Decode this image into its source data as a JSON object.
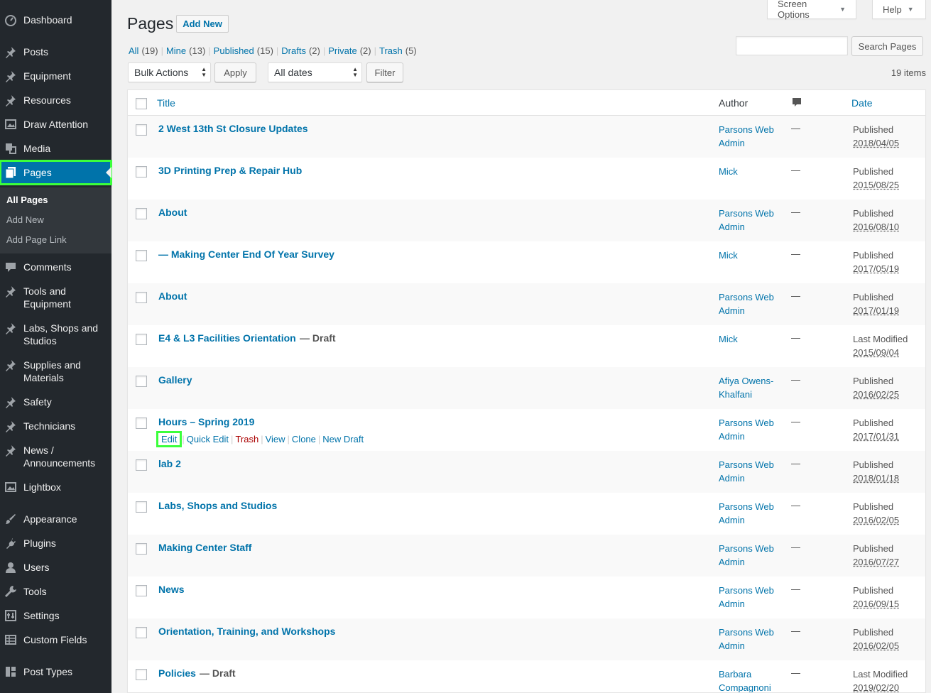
{
  "sidebar": {
    "items": [
      {
        "id": "dashboard",
        "label": "Dashboard",
        "icon": "dashboard-icon"
      },
      {
        "id": "posts",
        "label": "Posts",
        "icon": "pin-icon"
      },
      {
        "id": "equipment",
        "label": "Equipment",
        "icon": "pin-icon"
      },
      {
        "id": "resources",
        "label": "Resources",
        "icon": "pin-icon"
      },
      {
        "id": "draw-attention",
        "label": "Draw Attention",
        "icon": "image-icon"
      },
      {
        "id": "media",
        "label": "Media",
        "icon": "media-icon"
      },
      {
        "id": "pages",
        "label": "Pages",
        "icon": "page-icon"
      },
      {
        "id": "comments",
        "label": "Comments",
        "icon": "comment-icon"
      },
      {
        "id": "tools-equipment",
        "label": "Tools and Equipment",
        "icon": "pin-icon"
      },
      {
        "id": "labs",
        "label": "Labs, Shops and Studios",
        "icon": "pin-icon"
      },
      {
        "id": "supplies",
        "label": "Supplies and Materials",
        "icon": "pin-icon"
      },
      {
        "id": "safety",
        "label": "Safety",
        "icon": "pin-icon"
      },
      {
        "id": "technicians",
        "label": "Technicians",
        "icon": "pin-icon"
      },
      {
        "id": "news",
        "label": "News / Announcements",
        "icon": "pin-icon"
      },
      {
        "id": "lightbox",
        "label": "Lightbox",
        "icon": "image-icon"
      },
      {
        "id": "appearance",
        "label": "Appearance",
        "icon": "brush-icon"
      },
      {
        "id": "plugins",
        "label": "Plugins",
        "icon": "plugin-icon"
      },
      {
        "id": "users",
        "label": "Users",
        "icon": "user-icon"
      },
      {
        "id": "tools",
        "label": "Tools",
        "icon": "wrench-icon"
      },
      {
        "id": "settings",
        "label": "Settings",
        "icon": "settings-icon"
      },
      {
        "id": "custom-fields",
        "label": "Custom Fields",
        "icon": "table-icon"
      },
      {
        "id": "post-types",
        "label": "Post Types",
        "icon": "grid-icon"
      }
    ],
    "submenu": [
      "All Pages",
      "Add New",
      "Add Page Link"
    ]
  },
  "header": {
    "title": "Pages",
    "add_new": "Add New",
    "screen_options": "Screen Options",
    "help": "Help"
  },
  "views": [
    {
      "label": "All",
      "count": "(19)"
    },
    {
      "label": "Mine",
      "count": "(13)"
    },
    {
      "label": "Published",
      "count": "(15)"
    },
    {
      "label": "Drafts",
      "count": "(2)"
    },
    {
      "label": "Private",
      "count": "(2)"
    },
    {
      "label": "Trash",
      "count": "(5)"
    }
  ],
  "search": {
    "placeholder": "",
    "button": "Search Pages"
  },
  "filters": {
    "bulk_actions": "Bulk Actions",
    "apply": "Apply",
    "dates": "All dates",
    "filter": "Filter",
    "items_count": "19 items"
  },
  "table": {
    "headers": {
      "title": "Title",
      "author": "Author",
      "date": "Date"
    },
    "rows": [
      {
        "title": "2 West 13th St Closure Updates",
        "state": "",
        "author": "Parsons Web Admin",
        "comments": "—",
        "status": "Published",
        "date": "2018/04/05"
      },
      {
        "title": "3D Printing Prep & Repair Hub",
        "state": "",
        "author": "Mick",
        "comments": "—",
        "status": "Published",
        "date": "2015/08/25"
      },
      {
        "title": "About",
        "state": "",
        "author": "Parsons Web Admin",
        "comments": "—",
        "status": "Published",
        "date": "2016/08/10"
      },
      {
        "title": "— Making Center End Of Year Survey",
        "state": "",
        "author": "Mick",
        "comments": "—",
        "status": "Published",
        "date": "2017/05/19"
      },
      {
        "title": "About",
        "state": "",
        "author": "Parsons Web Admin",
        "comments": "—",
        "status": "Published",
        "date": "2017/01/19"
      },
      {
        "title": "E4 & L3 Facilities Orientation",
        "state": "— Draft",
        "author": "Mick",
        "comments": "—",
        "status": "Last Modified",
        "date": "2015/09/04"
      },
      {
        "title": "Gallery",
        "state": "",
        "author": "Afiya Owens-Khalfani",
        "comments": "—",
        "status": "Published",
        "date": "2016/02/25"
      },
      {
        "title": "Hours – Spring 2019",
        "state": "",
        "author": "Parsons Web Admin",
        "comments": "—",
        "status": "Published",
        "date": "2017/01/31"
      },
      {
        "title": "lab 2",
        "state": "",
        "author": "Parsons Web Admin",
        "comments": "—",
        "status": "Published",
        "date": "2018/01/18"
      },
      {
        "title": "Labs, Shops and Studios",
        "state": "",
        "author": "Parsons Web Admin",
        "comments": "—",
        "status": "Published",
        "date": "2016/02/05"
      },
      {
        "title": "Making Center Staff",
        "state": "",
        "author": "Parsons Web Admin",
        "comments": "—",
        "status": "Published",
        "date": "2016/07/27"
      },
      {
        "title": "News",
        "state": "",
        "author": "Parsons Web Admin",
        "comments": "—",
        "status": "Published",
        "date": "2016/09/15"
      },
      {
        "title": "Orientation, Training, and Workshops",
        "state": "",
        "author": "Parsons Web Admin",
        "comments": "—",
        "status": "Published",
        "date": "2016/02/05"
      },
      {
        "title": "Policies",
        "state": "— Draft",
        "author": "Barbara Compagnoni",
        "comments": "—",
        "status": "Last Modified",
        "date": "2019/02/20"
      }
    ],
    "row_actions": {
      "edit": "Edit",
      "quick_edit": "Quick Edit",
      "trash": "Trash",
      "view": "View",
      "clone": "Clone",
      "new_draft": "New Draft"
    }
  },
  "colors": {
    "accent": "#0073aa",
    "sidebar": "#23282d",
    "highlight": "#3bff3b",
    "trash": "#aa0000"
  }
}
